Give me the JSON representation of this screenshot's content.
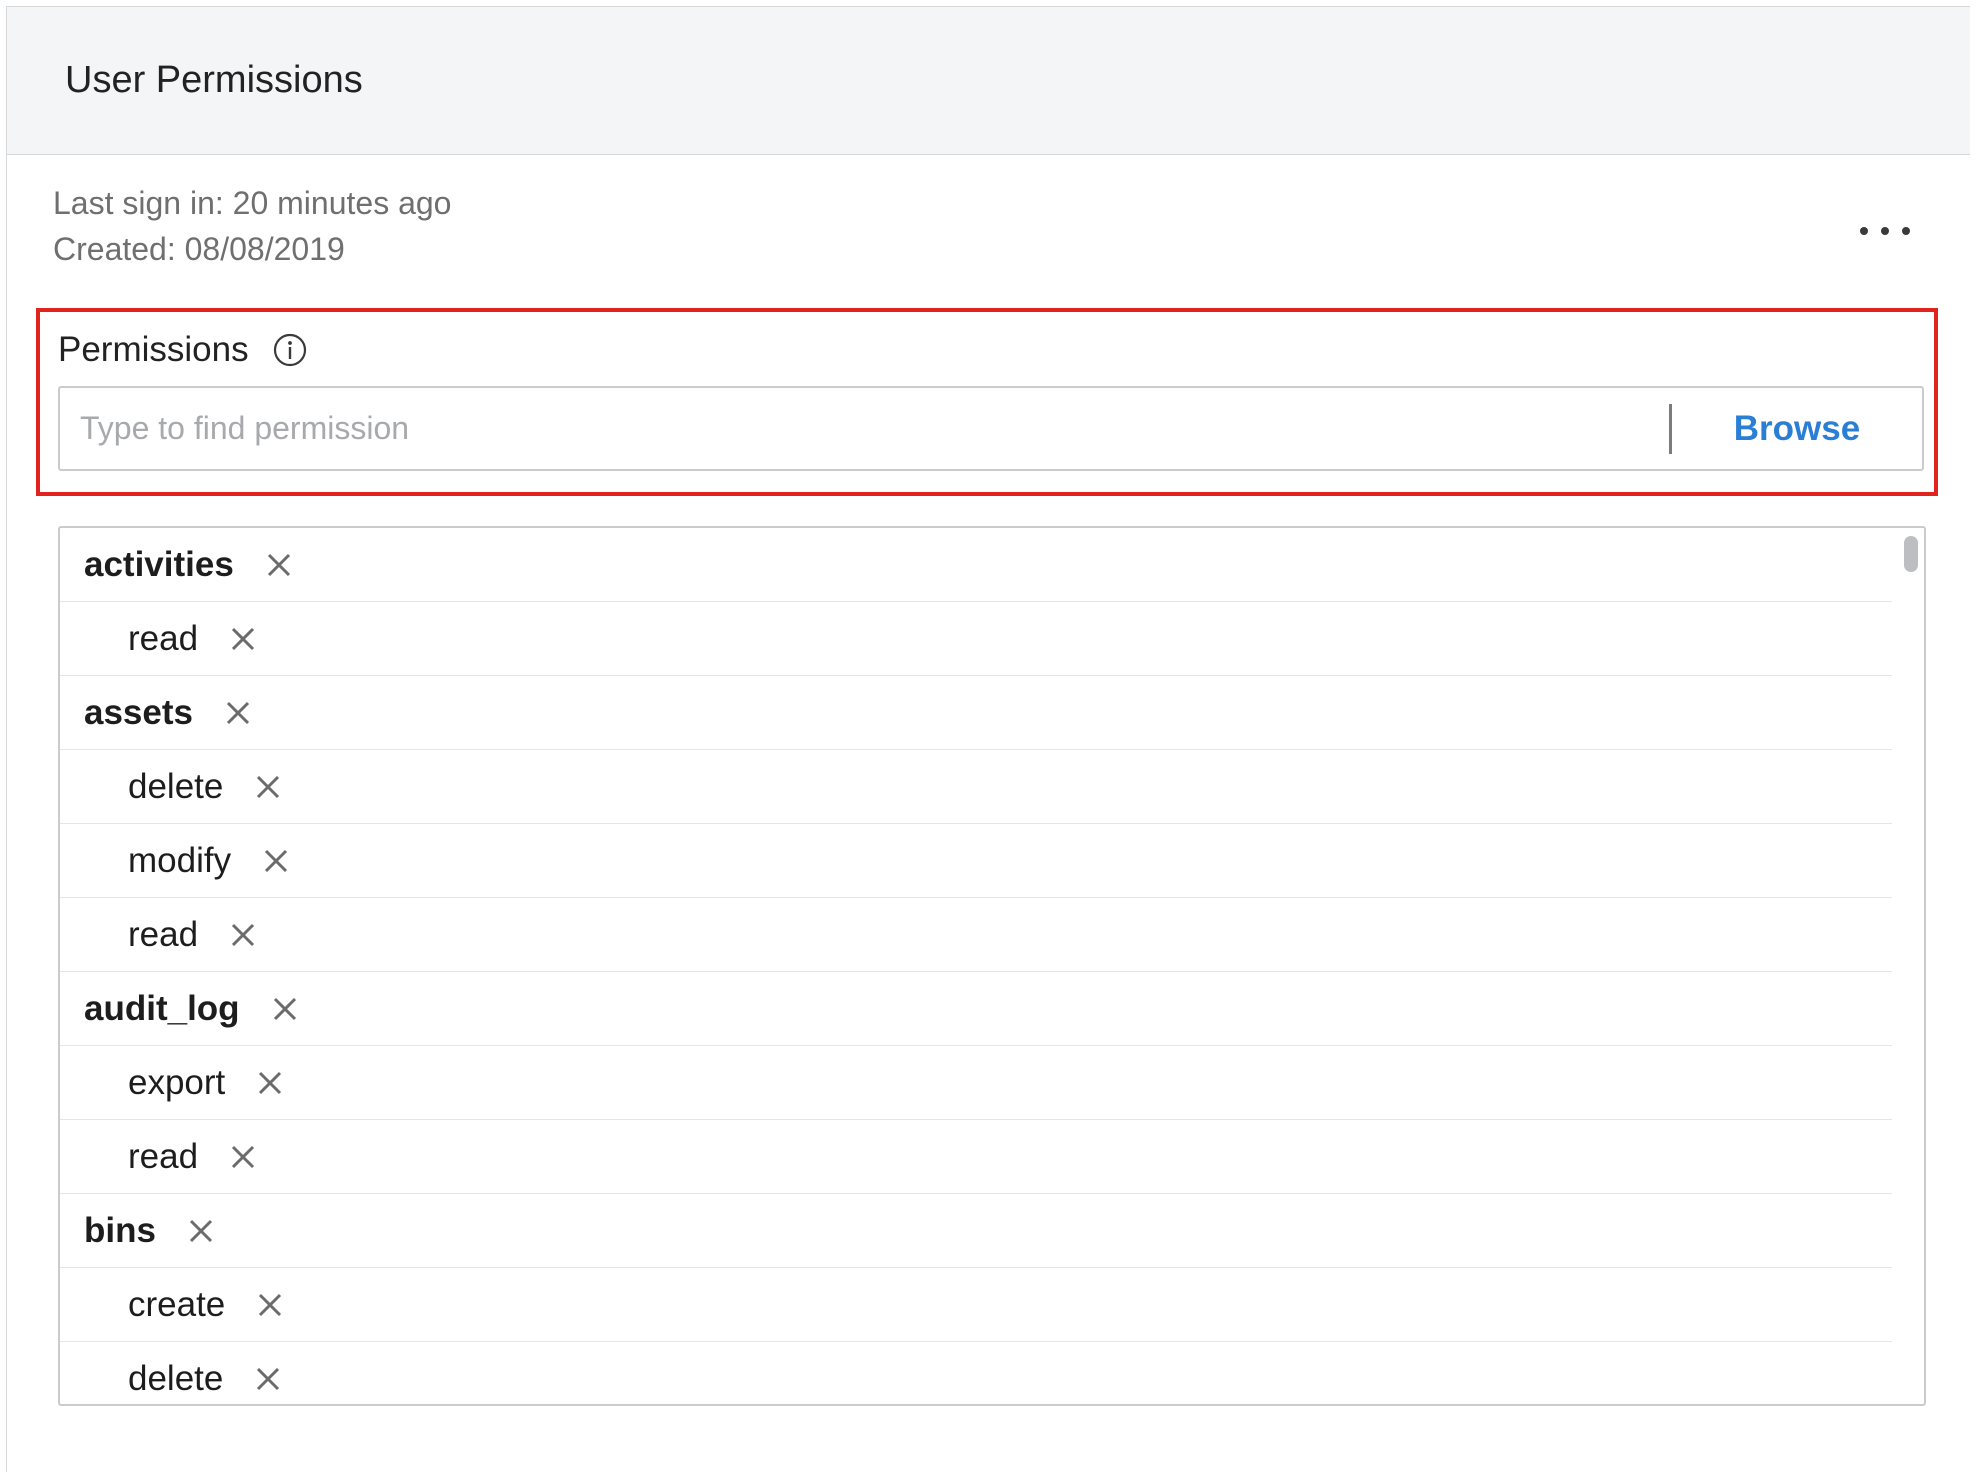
{
  "panel": {
    "title": "User Permissions"
  },
  "meta": {
    "last_sign_in": "Last sign in: 20 minutes ago",
    "created": "Created: 08/08/2019"
  },
  "more_menu": {
    "icon": "more-horizontal-icon"
  },
  "permissions": {
    "label": "Permissions",
    "info_icon": "info-icon",
    "search": {
      "placeholder": "Type to find permission",
      "value": ""
    },
    "browse_label": "Browse",
    "items": [
      {
        "name": "activities",
        "level": "group"
      },
      {
        "name": "read",
        "level": "child"
      },
      {
        "name": "assets",
        "level": "group"
      },
      {
        "name": "delete",
        "level": "child"
      },
      {
        "name": "modify",
        "level": "child"
      },
      {
        "name": "read",
        "level": "child"
      },
      {
        "name": "audit_log",
        "level": "group"
      },
      {
        "name": "export",
        "level": "child"
      },
      {
        "name": "read",
        "level": "child"
      },
      {
        "name": "bins",
        "level": "group"
      },
      {
        "name": "create",
        "level": "child"
      },
      {
        "name": "delete",
        "level": "child"
      }
    ],
    "remove_icon": "close-icon"
  },
  "colors": {
    "accent": "#2a7ed3",
    "highlight": "#e0241d",
    "header_bg": "#f4f5f6"
  }
}
